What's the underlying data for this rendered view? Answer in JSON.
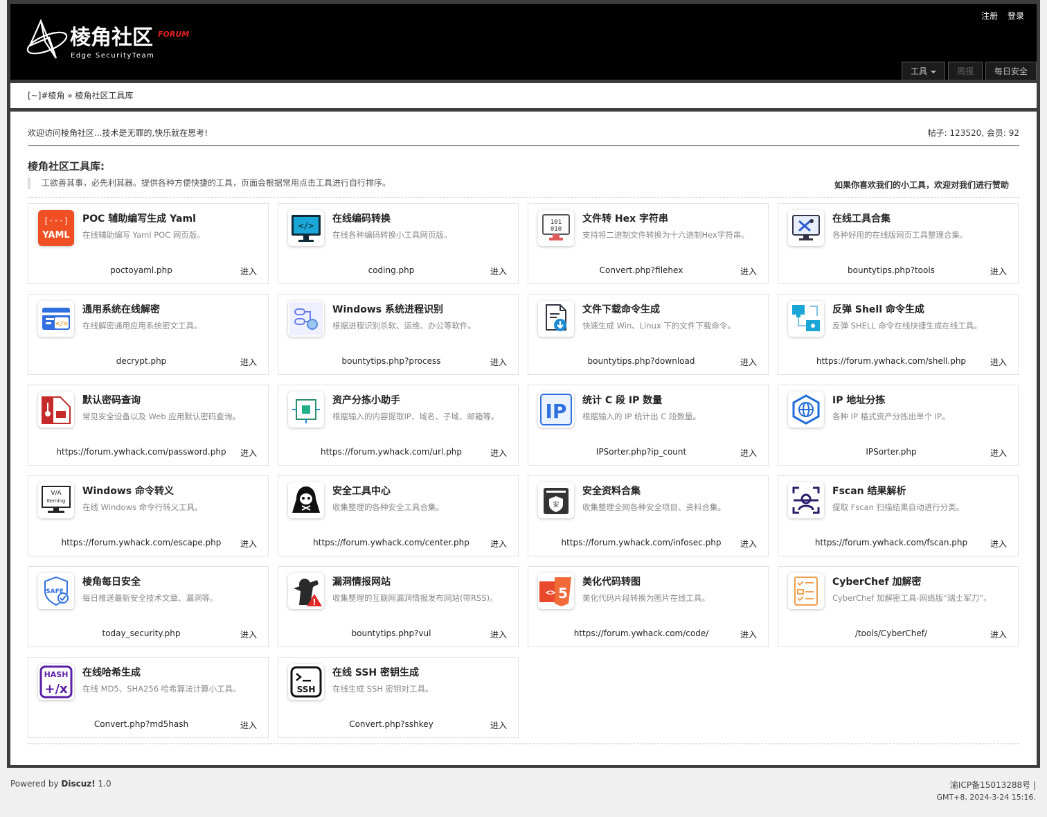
{
  "header": {
    "register": "注册",
    "login": "登录",
    "logo_text": "棱角社区",
    "logo_forum": "FORUM",
    "logo_sub": "Edge SecurityTeam",
    "nav": [
      {
        "label": "工具"
      },
      {
        "label": "周报"
      },
      {
        "label": "每日安全"
      }
    ]
  },
  "breadcrumb": {
    "home": "[~]#棱角",
    "sep": "»",
    "current": "棱角社区工具库"
  },
  "main": {
    "welcome": "欢迎访问棱角社区...技术是无罪的,快乐就在思考!",
    "stats": "帖子: 123520, 会员: 92",
    "title": "棱角社区工具库:",
    "quote": "工欲善其事，必先利其器。提供各种方便快捷的工具，页面会根据常用点击工具进行自行排序。",
    "sponsor": "如果你喜欢我们的小工具，欢迎对我们进行赞助"
  },
  "cards": [
    {
      "title": "POC 辅助编写生成 Yaml",
      "desc": "在线辅助编写 Yaml POC 网页版。",
      "url": "poctoyaml.php",
      "go": "进入",
      "icon": "yaml-icon"
    },
    {
      "title": "在线编码转换",
      "desc": "在线各种编码转换小工具网页版。",
      "url": "coding.php",
      "go": "进入",
      "icon": "code-monitor-icon"
    },
    {
      "title": "文件转 Hex 字符串",
      "desc": "支持将二进制文件转换为十六进制Hex字符串。",
      "url": "Convert.php?filehex",
      "go": "进入",
      "icon": "binary-monitor-icon"
    },
    {
      "title": "在线工具合集",
      "desc": "各种好用的在线版网页工具整理合集。",
      "url": "bountytips.php?tools",
      "go": "进入",
      "icon": "tools-monitor-icon"
    },
    {
      "title": "通用系统在线解密",
      "desc": "在线解密通用应用系统密文工具。",
      "url": "decrypt.php",
      "go": "进入",
      "icon": "decrypt-icon"
    },
    {
      "title": "Windows 系统进程识别",
      "desc": "根据进程识别杀软、运维、办公等软件。",
      "url": "bountytips.php?process",
      "go": "进入",
      "icon": "process-icon"
    },
    {
      "title": "文件下载命令生成",
      "desc": "快速生成 Win、Linux 下的文件下载命令。",
      "url": "bountytips.php?download",
      "go": "进入",
      "icon": "download-file-icon"
    },
    {
      "title": "反弹 Shell 命令生成",
      "desc": "反弹 SHELL 命令在线快捷生成在线工具。",
      "url": "https://forum.ywhack.com/shell.php",
      "go": "进入",
      "icon": "network-icon"
    },
    {
      "title": "默认密码查询",
      "desc": "常见安全设备以及 Web 应用默认密码查询。",
      "url": "https://forum.ywhack.com/password.php",
      "go": "进入",
      "icon": "password-icon"
    },
    {
      "title": "资产分拣小助手",
      "desc": "根据输入的内容提取IP、域名、子域、邮箱等。",
      "url": "https://forum.ywhack.com/url.php",
      "go": "进入",
      "icon": "sort-icon"
    },
    {
      "title": "统计 C 段 IP 数量",
      "desc": "根据输入的 IP 统计出 C 段数量。",
      "url": "IPSorter.php?ip_count",
      "go": "进入",
      "icon": "ip-icon"
    },
    {
      "title": "IP 地址分拣",
      "desc": "各种 IP 格式资产分拣出单个 IP。",
      "url": "IPSorter.php",
      "go": "进入",
      "icon": "globe-icon"
    },
    {
      "title": "Windows 命令转义",
      "desc": "在线 Windows 命令行转义工具。",
      "url": "https://forum.ywhack.com/escape.php",
      "go": "进入",
      "icon": "kerning-icon"
    },
    {
      "title": "安全工具中心",
      "desc": "收集整理的各种安全工具合集。",
      "url": "https://forum.ywhack.com/center.php",
      "go": "进入",
      "icon": "hacker-icon"
    },
    {
      "title": "安全资料合集",
      "desc": "收集整理全网各种安全项目、资料合集。",
      "url": "https://forum.ywhack.com/infosec.php",
      "go": "进入",
      "icon": "shield-doc-icon"
    },
    {
      "title": "Fscan 结果解析",
      "desc": "提取 Fscan 扫描结果自动进行分类。",
      "url": "https://forum.ywhack.com/fscan.php",
      "go": "进入",
      "icon": "scan-icon"
    },
    {
      "title": "棱角每日安全",
      "desc": "每日推送最新安全技术文章、漏洞等。",
      "url": "today_security.php",
      "go": "进入",
      "icon": "safe-icon"
    },
    {
      "title": "漏洞情报网站",
      "desc": "收集整理的互联网漏洞情报发布网站(带RSS)。",
      "url": "bountytips.php?vul",
      "go": "进入",
      "icon": "warning-icon"
    },
    {
      "title": "美化代码转图",
      "desc": "美化代码片段转换为图片在线工具。",
      "url": "https://forum.ywhack.com/code/",
      "go": "进入",
      "icon": "html5-icon"
    },
    {
      "title": "CyberChef 加解密",
      "desc": "CyberChef 加解密工具-网络版“瑞士军刀”。",
      "url": "/tools/CyberChef/",
      "go": "进入",
      "icon": "checklist-icon"
    },
    {
      "title": "在线哈希生成",
      "desc": "在线 MD5、SHA256 哈希算法计算小工具。",
      "url": "Convert.php?md5hash",
      "go": "进入",
      "icon": "hash-icon"
    },
    {
      "title": "在线 SSH 密钥生成",
      "desc": "在线生成 SSH 密钥对工具。",
      "url": "Convert.php?sshkey",
      "go": "进入",
      "icon": "ssh-icon"
    }
  ],
  "footer": {
    "powered_prefix": "Powered by ",
    "powered_brand": "Discuz!",
    "powered_ver": " 1.0",
    "icp": "渝ICP备15013288号 |",
    "time": "GMT+8, 2024-3-24 15:16."
  }
}
